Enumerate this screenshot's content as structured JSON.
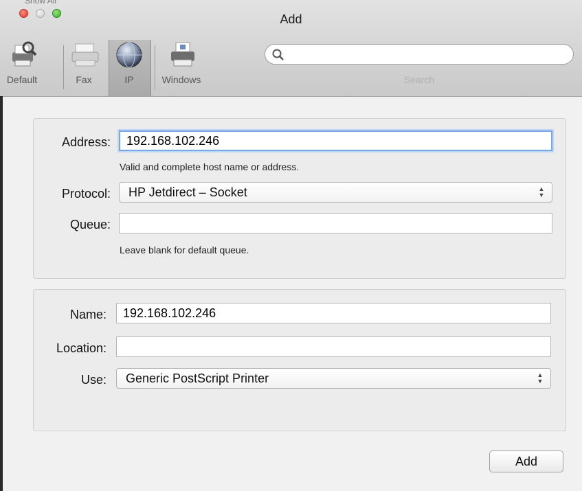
{
  "window": {
    "title": "Add",
    "behind_text": "Show All"
  },
  "toolbar": {
    "items": [
      {
        "label": "Default",
        "icon": "printer-magnifier-icon"
      },
      {
        "label": "Fax",
        "icon": "fax-icon"
      },
      {
        "label": "IP",
        "icon": "globe-icon",
        "selected": true
      },
      {
        "label": "Windows",
        "icon": "windows-printer-icon"
      }
    ],
    "search": {
      "value": "",
      "caption": "Search"
    }
  },
  "connection": {
    "address_label": "Address:",
    "address_value": "192.168.102.246",
    "address_hint": "Valid and complete host name or address.",
    "protocol_label": "Protocol:",
    "protocol_value": "HP Jetdirect – Socket",
    "queue_label": "Queue:",
    "queue_value": "",
    "queue_hint": "Leave blank for default queue."
  },
  "printer": {
    "name_label": "Name:",
    "name_value": "192.168.102.246",
    "location_label": "Location:",
    "location_value": "",
    "use_label": "Use:",
    "use_value": "Generic PostScript Printer"
  },
  "actions": {
    "add_label": "Add"
  },
  "colors": {
    "focus_ring": "#7aa7e4",
    "close": "#d6382b",
    "zoom": "#3aa72b"
  }
}
